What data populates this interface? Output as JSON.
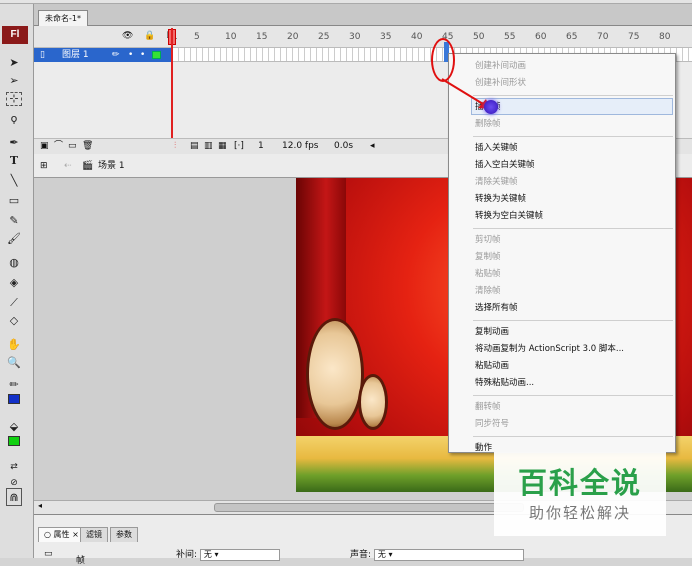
{
  "document": {
    "tab_title": "未命名-1*"
  },
  "toolbar": {
    "logo": "Fl"
  },
  "timeline": {
    "ruler_numbers": [
      "1",
      "5",
      "10",
      "15",
      "20",
      "25",
      "30",
      "35",
      "40",
      "45",
      "50",
      "55",
      "60",
      "65",
      "70",
      "75",
      "80"
    ],
    "layer_name": "图层 1",
    "header_icons": "👁 🔒 ☐",
    "bottom_bar": {
      "frame": "1",
      "fps": "12.0 fps",
      "time": "0.0s"
    }
  },
  "scene": {
    "name": "场景 1"
  },
  "context_menu": {
    "items": [
      {
        "label": "创建补间动画",
        "disabled": true
      },
      {
        "label": "创建补间形状",
        "disabled": true
      },
      {
        "label": "插入帧",
        "disabled": false,
        "highlighted": true
      },
      {
        "label": "删除帧",
        "disabled": true
      },
      {
        "label": "插入关键帧",
        "disabled": false
      },
      {
        "label": "插入空白关键帧",
        "disabled": false
      },
      {
        "label": "清除关键帧",
        "disabled": true
      },
      {
        "label": "转换为关键帧",
        "disabled": false
      },
      {
        "label": "转换为空白关键帧",
        "disabled": false
      },
      {
        "label": "剪切帧",
        "disabled": true
      },
      {
        "label": "复制帧",
        "disabled": true
      },
      {
        "label": "粘贴帧",
        "disabled": true
      },
      {
        "label": "清除帧",
        "disabled": true
      },
      {
        "label": "选择所有帧",
        "disabled": false
      },
      {
        "label": "复制动画",
        "disabled": false
      },
      {
        "label": "将动画复制为 ActionScript 3.0 脚本...",
        "disabled": false
      },
      {
        "label": "粘贴动画",
        "disabled": false
      },
      {
        "label": "特殊粘贴动画...",
        "disabled": false
      },
      {
        "label": "翻转帧",
        "disabled": true
      },
      {
        "label": "同步符号",
        "disabled": true
      },
      {
        "label": "動作",
        "disabled": false
      }
    ]
  },
  "properties": {
    "tabs": [
      "属性",
      "滤镜",
      "参数"
    ],
    "tween_label": "补间:",
    "tween_value": "无",
    "sound_label": "声音:",
    "sound_value": "无",
    "frame_label": "帧"
  },
  "watermark": {
    "title": "百科全说",
    "subtitle": "助你轻松解决"
  },
  "colors": {
    "accent_red": "#e01010",
    "layer_blue": "#2a66cc",
    "watermark_green": "#2aa04a"
  }
}
